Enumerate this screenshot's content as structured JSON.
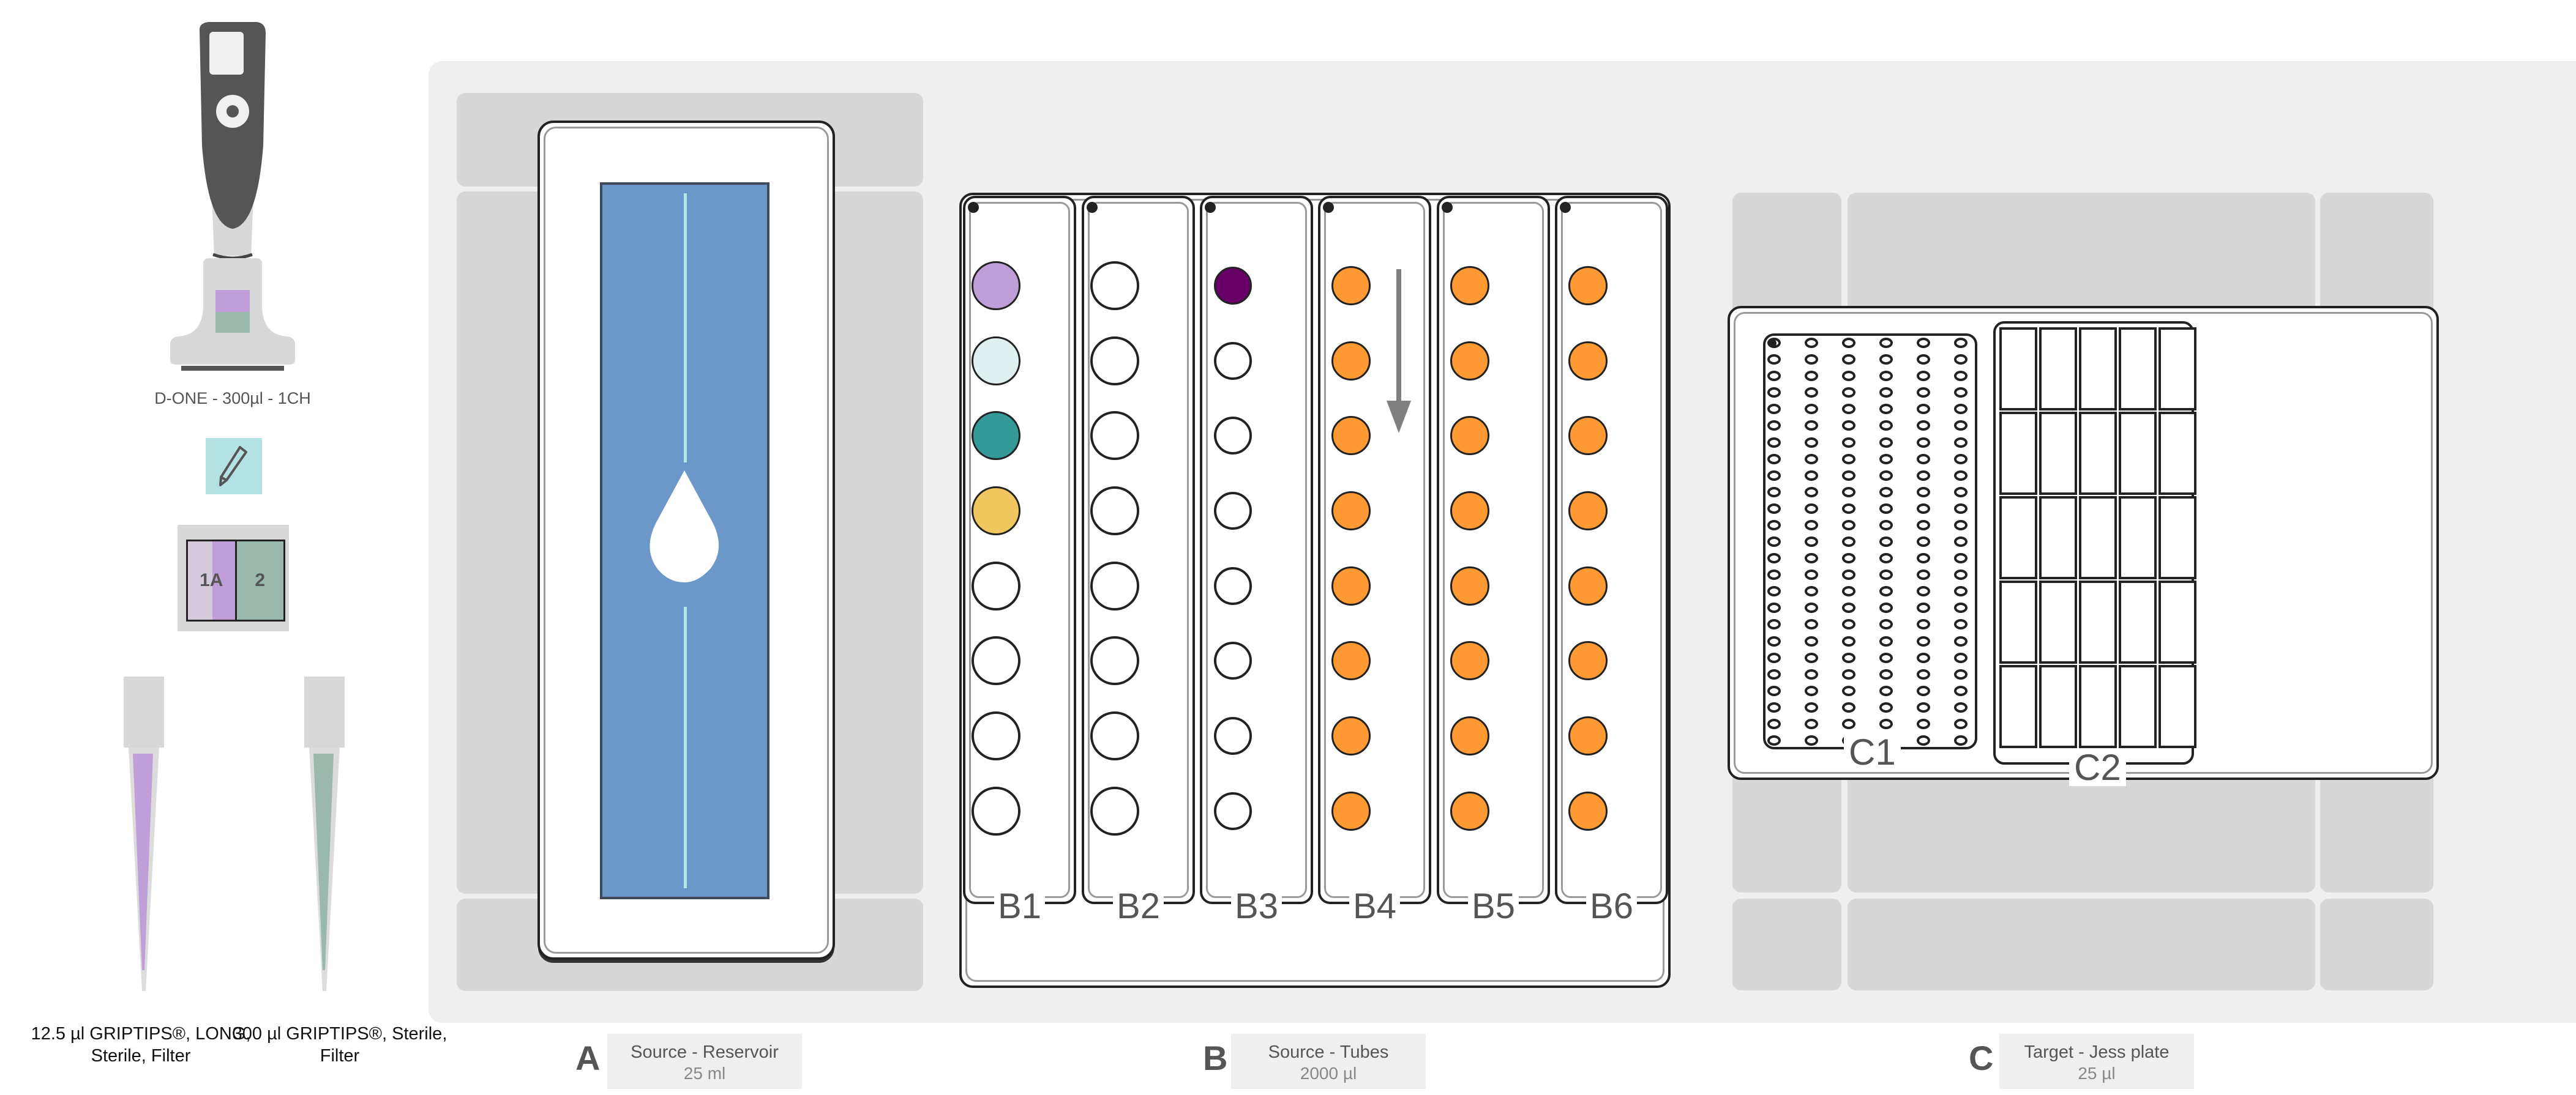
{
  "pipette": {
    "name": "D-ONE - 300µl - 1CH",
    "colors": {
      "body": "#555555",
      "grip": "#d8d8d8",
      "tip_slot_1": "#c09fd8",
      "tip_slot_2": "#9ab8ab"
    }
  },
  "edit_button": {
    "icon": "pencil-icon",
    "color": "#b4e2e2"
  },
  "tipbox": {
    "slots": [
      {
        "label": "1A",
        "color": "#c09fd8"
      },
      {
        "label": "2",
        "color": "#9ab8ab"
      }
    ]
  },
  "tips": [
    {
      "label": "12.5 µl GRIPTIPS®, LONG, Sterile, Filter",
      "color": "#c09fd8"
    },
    {
      "label": "300 µl GRIPTIPS®, Sterile, Filter",
      "color": "#9ab8ab"
    }
  ],
  "deck": {
    "slots": [
      {
        "letter": "A",
        "name": "Source - Reservoir",
        "volume": "25 ml",
        "labware": "reservoir",
        "liquid_color": "#6b98c9",
        "icon": "droplet-icon"
      },
      {
        "letter": "B",
        "name": "Source - Tubes",
        "volume": "2000 µl",
        "labware": "tube-rack",
        "strips": [
          {
            "label": "B1",
            "tubes": [
              "#c09fd8",
              "#e0eff0",
              "#339999",
              "#efc75e",
              "",
              "",
              "",
              ""
            ]
          },
          {
            "label": "B2",
            "tubes": [
              "",
              "",
              "",
              "",
              "",
              "",
              "",
              ""
            ]
          },
          {
            "label": "B3",
            "tubes": [
              "#660066",
              "",
              "",
              "",
              "",
              "",
              "",
              ""
            ]
          },
          {
            "label": "B4",
            "tubes": [
              "#ff9933",
              "#ff9933",
              "#ff9933",
              "#ff9933",
              "#ff9933",
              "#ff9933",
              "#ff9933",
              "#ff9933"
            ],
            "arrow": "down-arrow-icon"
          },
          {
            "label": "B5",
            "tubes": [
              "#ff9933",
              "#ff9933",
              "#ff9933",
              "#ff9933",
              "#ff9933",
              "#ff9933",
              "#ff9933",
              "#ff9933"
            ]
          },
          {
            "label": "B6",
            "tubes": [
              "#ff9933",
              "#ff9933",
              "#ff9933",
              "#ff9933",
              "#ff9933",
              "#ff9933",
              "#ff9933",
              "#ff9933"
            ]
          }
        ]
      },
      {
        "letter": "C",
        "name": "Target - Jess plate",
        "volume": "25 µl",
        "labware": "jess-plate",
        "sections": [
          {
            "label": "C1",
            "columns": 6,
            "rows": 25
          },
          {
            "label": "C2",
            "columns": 5,
            "rows": 5
          }
        ]
      }
    ]
  }
}
